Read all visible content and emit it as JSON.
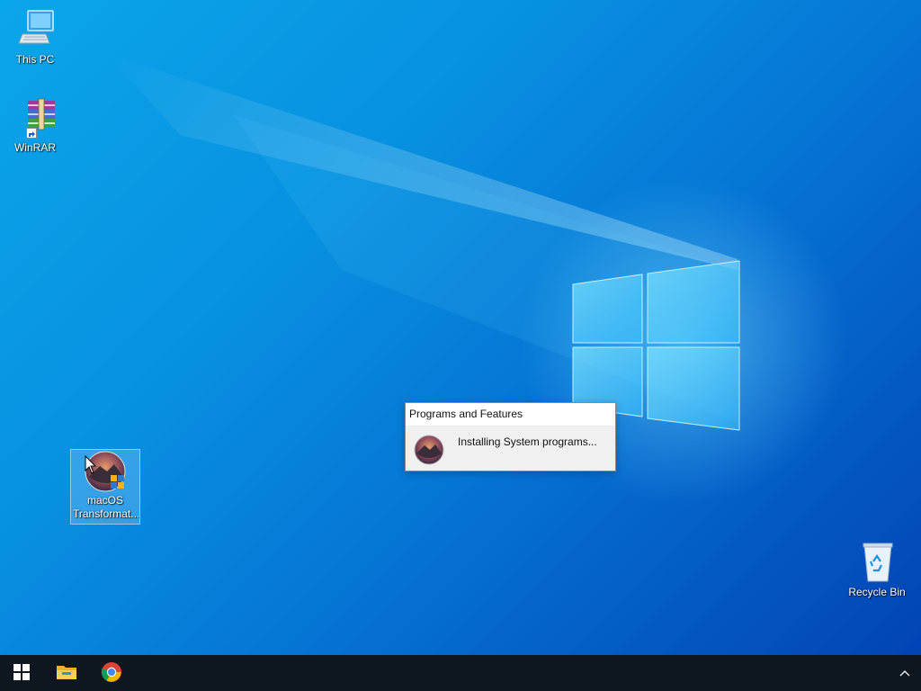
{
  "desktop": {
    "icons": [
      {
        "label": "This PC",
        "icon": "this-pc-icon"
      },
      {
        "label": "WinRAR",
        "icon": "winrar-icon"
      },
      {
        "label": "macOS Transformat...",
        "icon": "macos-transformation-icon"
      },
      {
        "label": "Recycle Bin",
        "icon": "recycle-bin-icon"
      }
    ]
  },
  "dialog": {
    "title": "Programs and Features",
    "status": "Installing System programs..."
  },
  "taskbar": {
    "items": [
      "start-icon",
      "file-explorer-icon",
      "chrome-icon"
    ],
    "tray": [
      "chevron-up-icon"
    ]
  },
  "colors": {
    "desktop_top": "#0aa6ea",
    "desktop_bottom": "#0243b6",
    "taskbar": "#0e1620"
  }
}
